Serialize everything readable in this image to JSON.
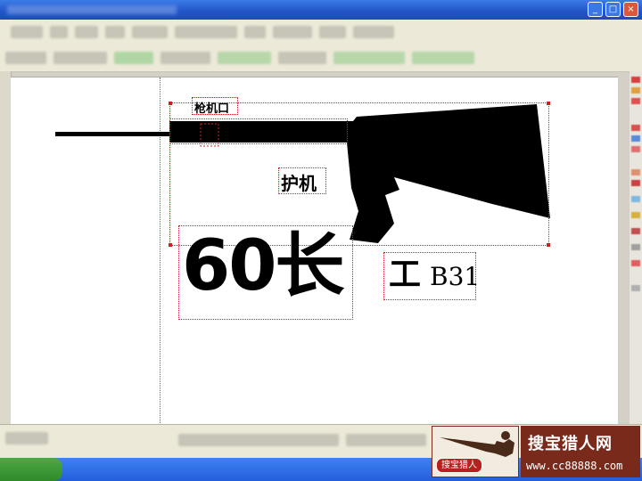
{
  "window": {
    "title_obscured": true,
    "buttons": [
      "minimize",
      "maximize",
      "close"
    ]
  },
  "canvas": {
    "labels": {
      "rifle_part_top": "枪机口",
      "rifle_part_mid": "护机",
      "big_text": "60长",
      "small_text_prefix": "工",
      "small_text_suffix": "B31"
    },
    "shape": "rifle-silhouette"
  },
  "watermark": {
    "site_name": "搜宝猎人网",
    "url": "www.cc88888.com",
    "seal_text": "搜宝猎人"
  },
  "colors": {
    "selection": "#cc2020",
    "titlebar": "#245edb",
    "watermark_bg": "#7a2a1a"
  }
}
